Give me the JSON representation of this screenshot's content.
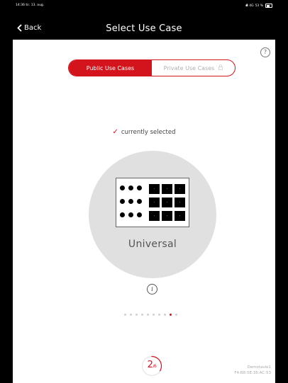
{
  "status": {
    "time": "14:36",
    "date": "tir. 13. aug.",
    "network": "4G",
    "battery": "53 %"
  },
  "nav": {
    "back_label": "Back",
    "title": "Select Use Case"
  },
  "segment": {
    "public_label": "Public Use Cases",
    "private_label": "Private Use Cases",
    "active": "public"
  },
  "selection": {
    "check": "✓",
    "label": "currently selected"
  },
  "usecase": {
    "name": "Universal"
  },
  "pager": {
    "total": 10,
    "current_index": 8
  },
  "counter": {
    "current": "2",
    "total": "6"
  },
  "device": {
    "name": "Demotavle1",
    "mac": "F4:B8:5E:35:AC:53"
  },
  "colors": {
    "accent": "#d4141c",
    "background": "#ffffff",
    "circle": "#e0e0e0"
  }
}
